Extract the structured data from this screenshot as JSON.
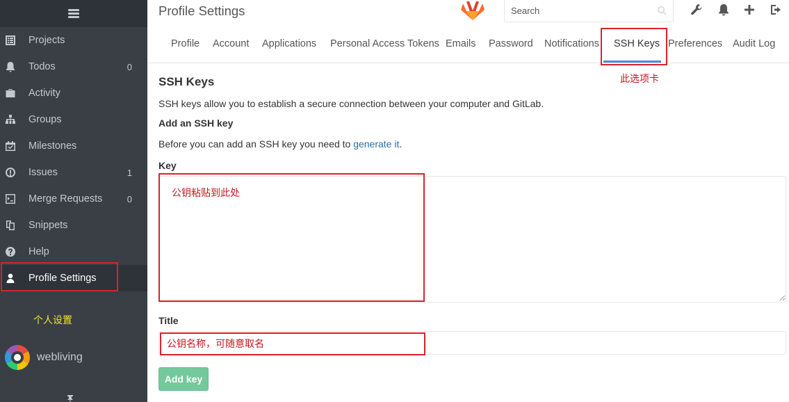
{
  "app": {
    "page_title": "Profile Settings",
    "search_placeholder": "Search"
  },
  "sidebar": {
    "items": [
      {
        "label": "Projects",
        "icon": "projects-icon",
        "count": ""
      },
      {
        "label": "Todos",
        "icon": "bell-icon",
        "count": "0"
      },
      {
        "label": "Activity",
        "icon": "briefcase-icon",
        "count": ""
      },
      {
        "label": "Groups",
        "icon": "sitemap-icon",
        "count": ""
      },
      {
        "label": "Milestones",
        "icon": "calendar-check-icon",
        "count": ""
      },
      {
        "label": "Issues",
        "icon": "exclamation-circle-icon",
        "count": "1"
      },
      {
        "label": "Merge Requests",
        "icon": "merge-request-icon",
        "count": "0"
      },
      {
        "label": "Snippets",
        "icon": "clipboard-icon",
        "count": ""
      },
      {
        "label": "Help",
        "icon": "question-circle-icon",
        "count": ""
      },
      {
        "label": "Profile Settings",
        "icon": "user-icon",
        "count": "",
        "active": true
      }
    ],
    "user_name": "webliving"
  },
  "tabs": [
    "Profile",
    "Account",
    "Applications",
    "Personal Access Tokens",
    "Emails",
    "Password",
    "Notifications",
    "SSH Keys",
    "Preferences",
    "Audit Log"
  ],
  "active_tab": "SSH Keys",
  "content": {
    "heading": "SSH Keys",
    "description": "SSH keys allow you to establish a secure connection between your computer and GitLab.",
    "subheading": "Add an SSH key",
    "before_text": "Before you can add an SSH key you need to",
    "generate_link": "generate it",
    "after_text": ".",
    "key_label": "Key",
    "key_value": "",
    "title_label": "Title",
    "title_value": "",
    "submit_label": "Add key"
  },
  "annotations": {
    "tab_note": "此选项卡",
    "key_note": "公钥粘贴到此处",
    "title_note": "公钥名称，可随意取名",
    "sidebar_note": "个人设置"
  },
  "colors": {
    "sidebar_bg": "#393f45",
    "accent_blue": "#4a8bdb",
    "button_green": "#5bc08a",
    "annotation_red": "#d8232a",
    "annotation_yellow": "#f4e32e"
  }
}
